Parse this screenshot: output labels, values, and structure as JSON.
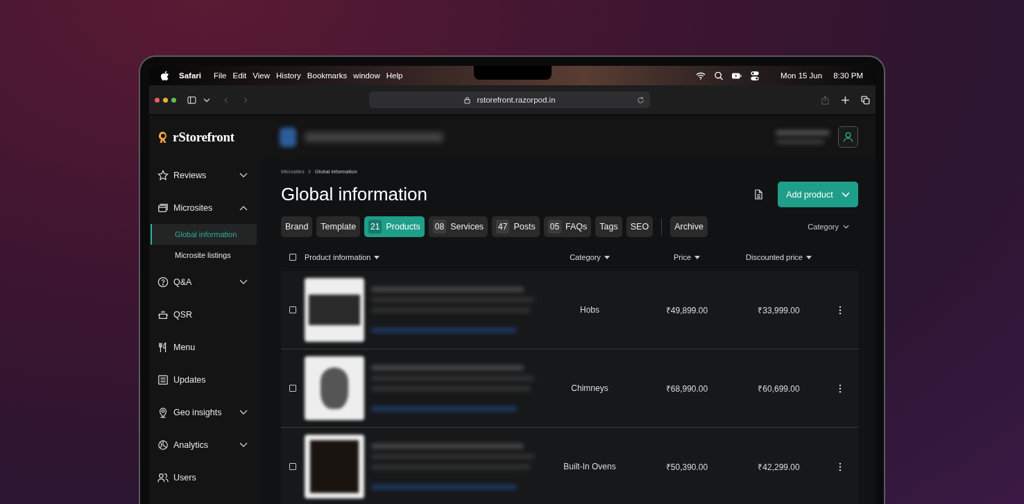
{
  "menubar": {
    "app": "Safari",
    "menus": [
      "File",
      "Edit",
      "View",
      "History",
      "Bookmarks",
      "window",
      "Help"
    ],
    "date": "Mon 15 Jun",
    "time": "8:30 PM"
  },
  "browser": {
    "url": "rstorefront.razorpod.in"
  },
  "sidebar": {
    "brand": "rStorefront",
    "items": [
      {
        "label": "Reviews",
        "kind": "group",
        "expanded": false
      },
      {
        "label": "Microsites",
        "kind": "group",
        "expanded": true,
        "children": [
          {
            "label": "Global information",
            "selected": true
          },
          {
            "label": "Microsite listings",
            "selected": false
          }
        ]
      },
      {
        "label": "Q&A",
        "kind": "group",
        "expanded": false
      },
      {
        "label": "QSR",
        "kind": "link"
      },
      {
        "label": "Menu",
        "kind": "link"
      },
      {
        "label": "Updates",
        "kind": "link"
      },
      {
        "label": "Geo insights",
        "kind": "group",
        "expanded": false
      },
      {
        "label": "Analytics",
        "kind": "group",
        "expanded": false
      },
      {
        "label": "Users",
        "kind": "link"
      }
    ]
  },
  "breadcrumb": [
    "Microsites",
    "Global information"
  ],
  "title": "Global information",
  "add_button": "Add product",
  "tabs": [
    {
      "label": "Brand",
      "selected": false
    },
    {
      "label": "Template",
      "selected": false
    },
    {
      "count": "21",
      "label": "Products",
      "selected": true
    },
    {
      "count": "08",
      "label": "Services",
      "selected": false
    },
    {
      "count": "47",
      "label": "Posts",
      "selected": false
    },
    {
      "count": "05",
      "label": "FAQs",
      "selected": false
    },
    {
      "label": "Tags",
      "selected": false
    },
    {
      "label": "SEO",
      "selected": false
    }
  ],
  "archive_tab": {
    "label": "Archive",
    "selected": false
  },
  "filter": "Category",
  "table": {
    "select_all": {
      "checked": false
    },
    "columns": [
      "Product information",
      "Category",
      "Price",
      "Discounted price"
    ],
    "rows": [
      {
        "checked": false,
        "category": "Hobs",
        "price": "₹49,899.00",
        "discounted_price": "₹33,999.00"
      },
      {
        "checked": false,
        "category": "Chimneys",
        "price": "₹68,990.00",
        "discounted_price": "₹60,699.00"
      },
      {
        "checked": false,
        "category": "Built-In Ovens",
        "price": "₹50,390.00",
        "discounted_price": "₹42,299.00"
      }
    ]
  }
}
